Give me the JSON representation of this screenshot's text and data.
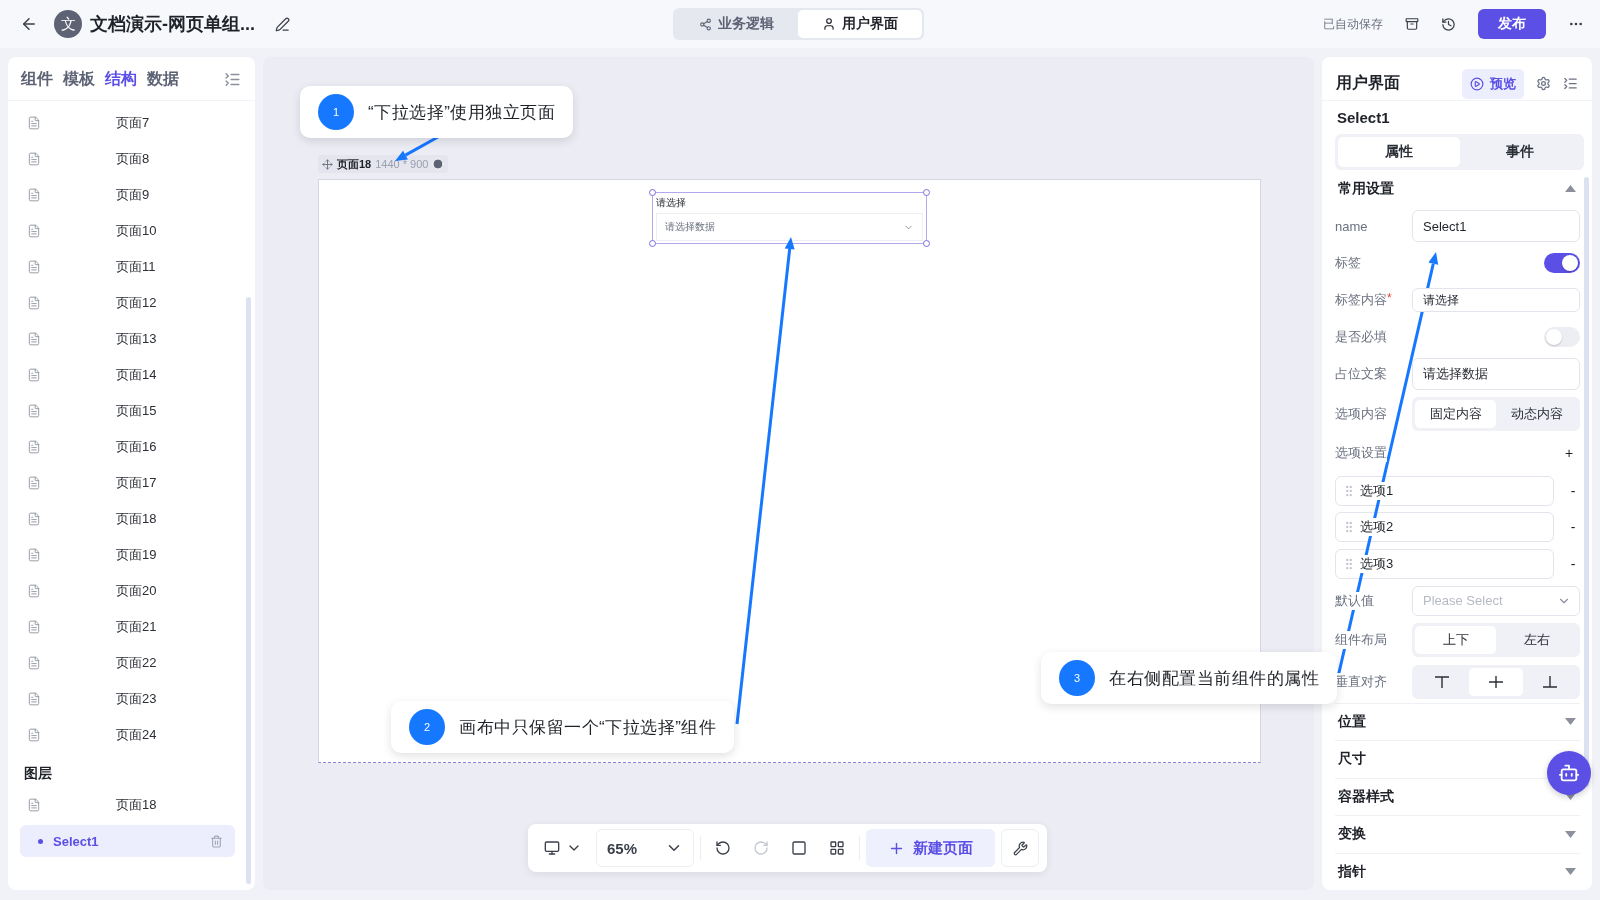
{
  "topbar": {
    "title": "文档演示-网页单组...",
    "avatar": "文",
    "mode_tabs": [
      {
        "label": "业务逻辑",
        "selected": false
      },
      {
        "label": "用户界面",
        "selected": true
      }
    ],
    "autosave": "已自动保存",
    "publish": "发布"
  },
  "left_panel": {
    "tabs": [
      {
        "label": "组件",
        "selected": false
      },
      {
        "label": "模板",
        "selected": false
      },
      {
        "label": "结构",
        "selected": true
      },
      {
        "label": "数据",
        "selected": false
      }
    ],
    "pages": [
      "页面7",
      "页面8",
      "页面9",
      "页面10",
      "页面11",
      "页面12",
      "页面13",
      "页面14",
      "页面15",
      "页面16",
      "页面17",
      "页面18",
      "页面19",
      "页面20",
      "页面21",
      "页面22",
      "页面23",
      "页面24"
    ],
    "layers_title": "图层",
    "layers": [
      {
        "label": "页面18",
        "children": [
          {
            "label": "Select1",
            "selected": true
          }
        ]
      }
    ]
  },
  "canvas": {
    "page_label": "页面18",
    "page_size": "1440 * 900",
    "widget": {
      "label": "请选择",
      "placeholder": "请选择数据"
    },
    "annotations": [
      {
        "number": "1",
        "text": "“下拉选择”使用独立页面"
      },
      {
        "number": "2",
        "text": "画布中只保留一个“下拉选择”组件"
      },
      {
        "number": "3",
        "text": "在右侧配置当前组件的属性"
      }
    ],
    "toolbar": {
      "zoom": "65%",
      "new_page": "新建页面"
    }
  },
  "right_panel": {
    "title": "用户界面",
    "preview": "预览",
    "component": "Select1",
    "tabs": [
      {
        "label": "属性",
        "selected": true
      },
      {
        "label": "事件",
        "selected": false
      }
    ],
    "section": {
      "title": "常用设置",
      "expanded": true
    },
    "fields": [
      {
        "kind": "input",
        "label": "name",
        "value": "Select1"
      },
      {
        "kind": "switch",
        "label": "标签",
        "on": true
      },
      {
        "kind": "input",
        "label": "标签内容",
        "required_mark": "*",
        "value": "请选择"
      },
      {
        "kind": "switch",
        "label": "是否必填",
        "on": false
      },
      {
        "kind": "input",
        "label": "占位文案",
        "value": "请选择数据"
      },
      {
        "kind": "segmented",
        "label": "选项内容",
        "options": [
          {
            "label": "固定内容",
            "selected": true
          },
          {
            "label": "动态内容",
            "selected": false
          }
        ]
      },
      {
        "kind": "options",
        "label": "选项设置",
        "add": "+",
        "items": [
          {
            "value": "选项1",
            "remove": "-"
          },
          {
            "value": "选项2",
            "remove": "-"
          },
          {
            "value": "选项3",
            "remove": "-"
          }
        ]
      },
      {
        "kind": "select",
        "label": "默认值",
        "placeholder": "Please Select"
      },
      {
        "kind": "segmented",
        "label": "组件布局",
        "options": [
          {
            "label": "上下",
            "selected": true
          },
          {
            "label": "左右",
            "selected": false
          }
        ]
      },
      {
        "kind": "align",
        "label": "垂直对齐",
        "options": [
          {
            "kind": "top",
            "selected": false
          },
          {
            "kind": "middle",
            "selected": true
          },
          {
            "kind": "bottom",
            "selected": false
          }
        ]
      }
    ],
    "sections": [
      {
        "title": "位置",
        "expanded": false
      },
      {
        "title": "尺寸",
        "expanded": false
      },
      {
        "title": "容器样式",
        "expanded": false
      },
      {
        "title": "变换",
        "expanded": false
      },
      {
        "title": "指针",
        "expanded": false
      }
    ]
  }
}
